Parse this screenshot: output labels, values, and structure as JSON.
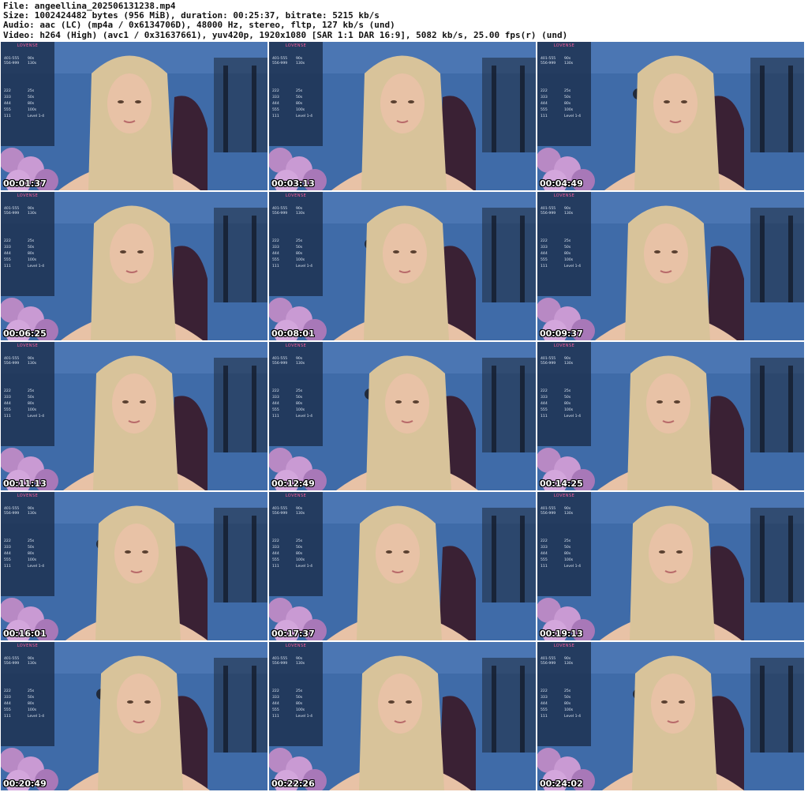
{
  "header": {
    "file_line": "File: angeellina_202506131238.mp4",
    "size_line": "Size: 1002424482 bytes (956 MiB), duration: 00:25:37, bitrate: 5215 kb/s",
    "audio_line": "Audio: aac (LC) (mp4a / 0x6134706D), 48000 Hz, stereo, fltp, 127 kb/s (und)",
    "video_line": "Video: h264 (High) (avc1 / 0x31637661), yuv420p, 1920x1080 [SAR 1:1 DAR 16:9], 5082 kb/s, 25.00 fps(r) (und)"
  },
  "overlay": {
    "brand": "LOVENSE",
    "rows": [
      {
        "range": "401-555",
        "time": "90s"
      },
      {
        "range": "556-999",
        "time": "130s"
      },
      {
        "range": "222",
        "time": "25s"
      },
      {
        "range": "333",
        "time": "50s"
      },
      {
        "range": "444",
        "time": "80s"
      },
      {
        "range": "555",
        "time": "100s"
      },
      {
        "range": "111",
        "time": "Level 1-4"
      }
    ]
  },
  "thumbnails": [
    {
      "timestamp": "00:01:37"
    },
    {
      "timestamp": "00:03:13"
    },
    {
      "timestamp": "00:04:49"
    },
    {
      "timestamp": "00:06:25"
    },
    {
      "timestamp": "00:08:01"
    },
    {
      "timestamp": "00:09:37"
    },
    {
      "timestamp": "00:11:13"
    },
    {
      "timestamp": "00:12:49"
    },
    {
      "timestamp": "00:14:25"
    },
    {
      "timestamp": "00:16:01"
    },
    {
      "timestamp": "00:17:37"
    },
    {
      "timestamp": "00:19:13"
    },
    {
      "timestamp": "00:20:49"
    },
    {
      "timestamp": "00:22:26"
    },
    {
      "timestamp": "00:24:02"
    }
  ],
  "colors": {
    "wall": "#3f6ba8",
    "hair": "#d8c39a",
    "skin": "#e8c2a6",
    "top": "#141418",
    "flowers": "#b889c4",
    "panel": "#1c304e"
  }
}
